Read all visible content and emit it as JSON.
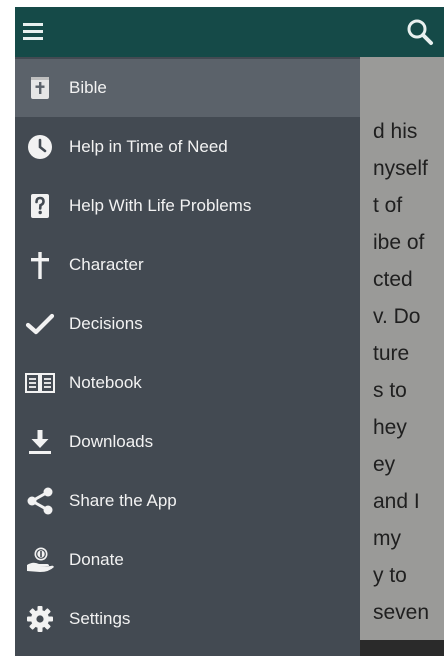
{
  "toolbar": {
    "menu_icon": "hamburger-icon",
    "search_icon": "search-icon",
    "background_color": "#154a48"
  },
  "reading_text": {
    "lines": [
      "d his",
      "nyself",
      "t of",
      "ibe of",
      "cted",
      "v. Do",
      "ture",
      "s to",
      "hey",
      "ey",
      " and I",
      "my",
      "y to",
      "seven"
    ]
  },
  "drawer": {
    "background_color": "#434a52",
    "active_color": "#5b626a",
    "items": [
      {
        "label": "Bible",
        "icon": "bible-icon",
        "active": true
      },
      {
        "label": "Help in Time of Need",
        "icon": "clock-icon"
      },
      {
        "label": "Help With Life Problems",
        "icon": "question-icon"
      },
      {
        "label": "Character",
        "icon": "cross-icon"
      },
      {
        "label": "Decisions",
        "icon": "checkmark-icon"
      },
      {
        "label": "Notebook",
        "icon": "notebook-icon"
      },
      {
        "label": "Downloads",
        "icon": "download-icon"
      },
      {
        "label": "Share the App",
        "icon": "share-icon"
      },
      {
        "label": "Donate",
        "icon": "donate-icon"
      },
      {
        "label": "Settings",
        "icon": "gear-icon"
      }
    ]
  }
}
